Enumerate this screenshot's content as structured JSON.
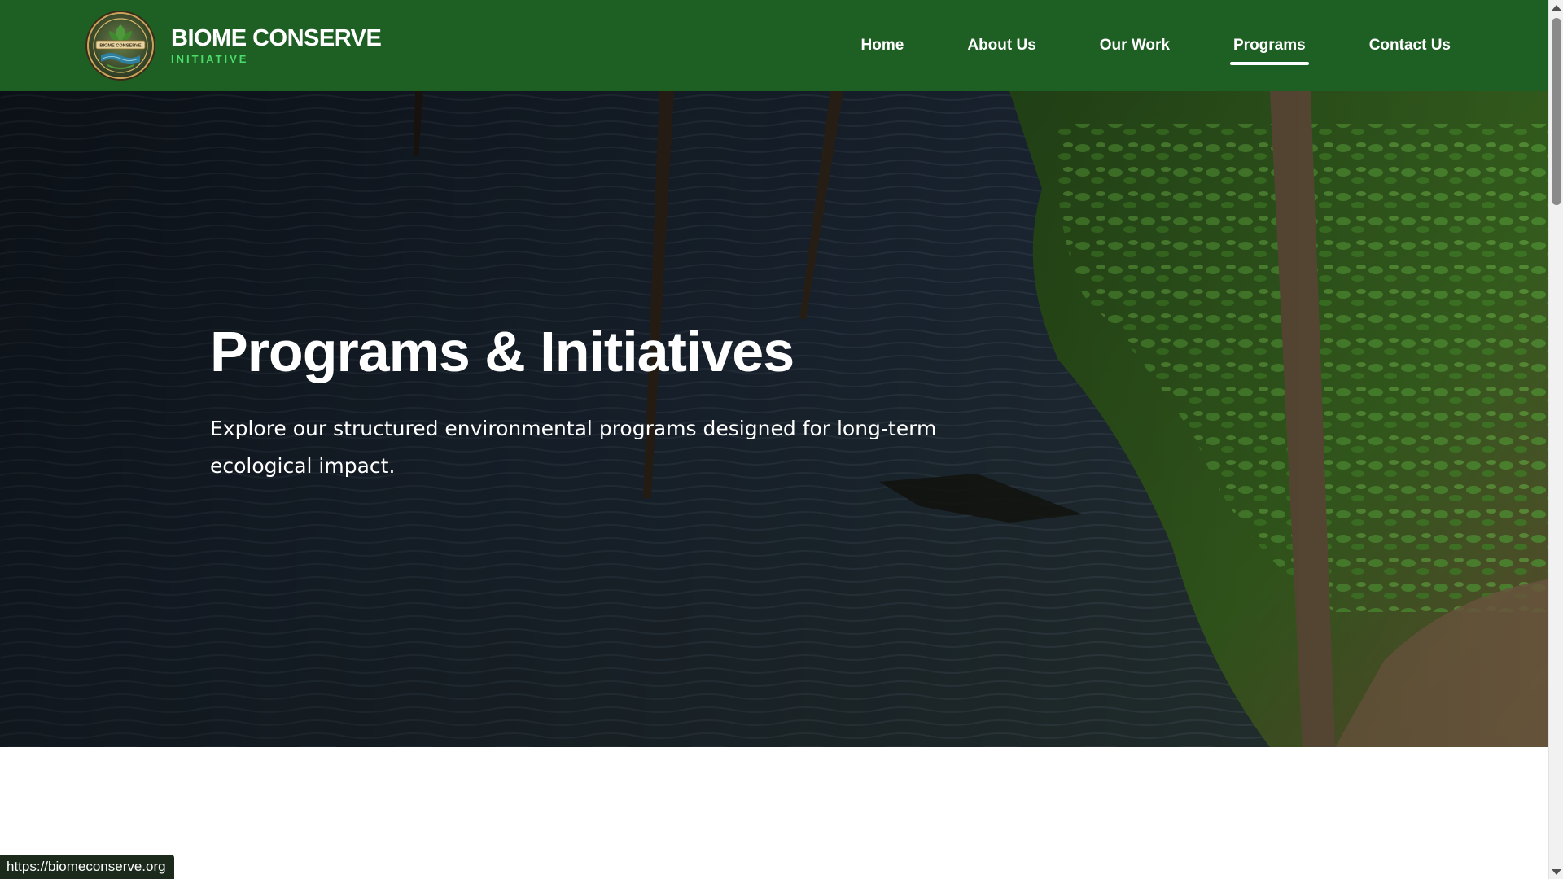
{
  "brand": {
    "name": "BIOME CONSERVE",
    "subtitle": "INITIATIVE",
    "logo_text": "BIOME CONSERVE"
  },
  "nav": {
    "items": [
      {
        "label": "Home",
        "active": false
      },
      {
        "label": "About Us",
        "active": false
      },
      {
        "label": "Our Work",
        "active": false
      },
      {
        "label": "Programs",
        "active": true
      },
      {
        "label": "Contact Us",
        "active": false
      }
    ]
  },
  "hero": {
    "title": "Programs & Initiatives",
    "description": "Explore our structured environmental programs designed for long-term ecological impact."
  },
  "status_bar": {
    "url": "https://biomeconserve.org"
  },
  "colors": {
    "header_bg": "#1e5f24",
    "accent_green": "#4cdc6a",
    "text_white": "#ffffff"
  }
}
